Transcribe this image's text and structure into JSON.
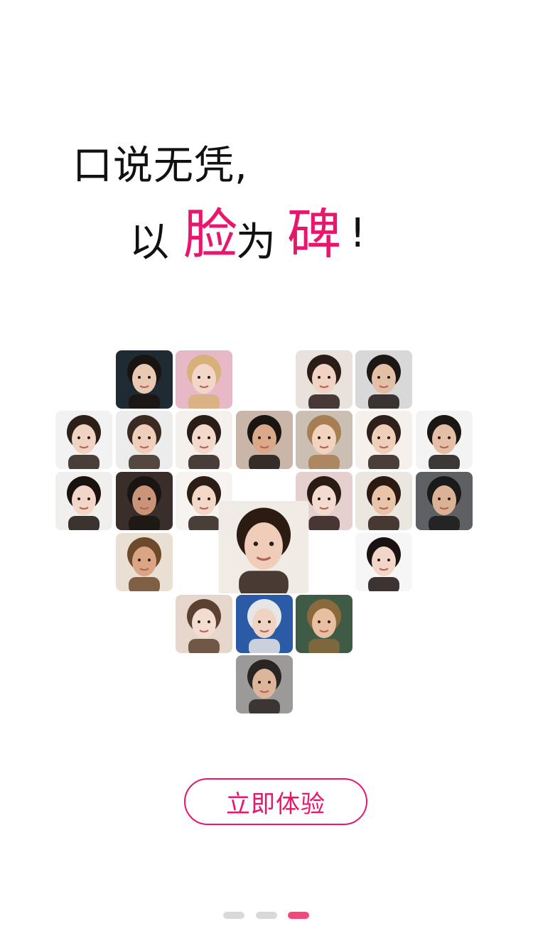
{
  "headline": {
    "line1": "口说无凭,",
    "line2": {
      "yi": "以",
      "lian": "脸",
      "wei": "为",
      "bei": "碑",
      "ex": "!"
    }
  },
  "colors": {
    "accent": "#e8166c",
    "dot_inactive": "#d9d9d9",
    "dot_active": "#f2487a",
    "text": "#111111"
  },
  "faces": [
    {
      "name": "face-photo-01",
      "bg": "#1f2a33",
      "skin": "#e9c9b4",
      "hair": "#1a1410"
    },
    {
      "name": "face-photo-02",
      "bg": "#e7b9c6",
      "skin": "#f2d6c8",
      "hair": "#d8b07a"
    },
    {
      "name": "face-photo-03",
      "bg": "#e9e2dc",
      "skin": "#f0d3c3",
      "hair": "#2a1c16"
    },
    {
      "name": "face-photo-04",
      "bg": "#d8d8d8",
      "skin": "#e3bfa6",
      "hair": "#1d1714"
    },
    {
      "name": "face-photo-05",
      "bg": "#f2f2f2",
      "skin": "#f0d3c3",
      "hair": "#2b1f18"
    },
    {
      "name": "face-photo-06",
      "bg": "#ececec",
      "skin": "#efcfbc",
      "hair": "#3a2a22"
    },
    {
      "name": "face-photo-07",
      "bg": "#f4f0ee",
      "skin": "#f3d9ca",
      "hair": "#2a1d17"
    },
    {
      "name": "face-photo-08",
      "bg": "#c9b6a8",
      "skin": "#d9a98a",
      "hair": "#1b1512"
    },
    {
      "name": "face-photo-09",
      "bg": "#cbbfb4",
      "skin": "#f1d3bf",
      "hair": "#a77d52"
    },
    {
      "name": "face-photo-10",
      "bg": "#f5f0ec",
      "skin": "#f0cfba",
      "hair": "#2d1f19"
    },
    {
      "name": "face-photo-11",
      "bg": "#f3f3f3",
      "skin": "#e4bfa6",
      "hair": "#1a1614"
    },
    {
      "name": "face-photo-12",
      "bg": "#f1efee",
      "skin": "#f2d6c7",
      "hair": "#1a120e"
    },
    {
      "name": "face-photo-13",
      "bg": "#3a2e2a",
      "skin": "#c99478",
      "hair": "#1a1512"
    },
    {
      "name": "face-photo-14",
      "bg": "#f6f3f1",
      "skin": "#f3d8c8",
      "hair": "#2b1e17"
    },
    {
      "name": "face-photo-15",
      "bg": "#e6d0cf",
      "skin": "#f3dccf",
      "hair": "#2a1b15"
    },
    {
      "name": "face-photo-16",
      "bg": "#ece6e1",
      "skin": "#e9c4a8",
      "hair": "#2a1a12"
    },
    {
      "name": "face-photo-17",
      "bg": "#5e6063",
      "skin": "#dcb297",
      "hair": "#1b1a1a"
    },
    {
      "name": "face-photo-18",
      "bg": "#eadfd3",
      "skin": "#d9a582",
      "hair": "#6d4a2b"
    },
    {
      "name": "face-photo-19",
      "bg": "#f6f6f6",
      "skin": "#f2d7c8",
      "hair": "#1a1210"
    },
    {
      "name": "face-photo-20",
      "bg": "#e7d6cc",
      "skin": "#f3dcd0",
      "hair": "#5a4130"
    },
    {
      "name": "face-photo-21",
      "bg": "#2b5aa6",
      "skin": "#efd4c4",
      "hair": "#e6e6e6"
    },
    {
      "name": "face-photo-22",
      "bg": "#3f5b45",
      "skin": "#e9bfa2",
      "hair": "#8a6a3c"
    },
    {
      "name": "face-photo-23",
      "bg": "#9c9a98",
      "skin": "#dcb59b",
      "hair": "#2a2522"
    },
    {
      "name": "face-photo-24",
      "bg": "#f1ebe6",
      "skin": "#efcdb9",
      "hair": "#2b1b13"
    }
  ],
  "cta": {
    "label": "立即体验"
  },
  "pager": {
    "pages": 3,
    "active_index": 2
  }
}
